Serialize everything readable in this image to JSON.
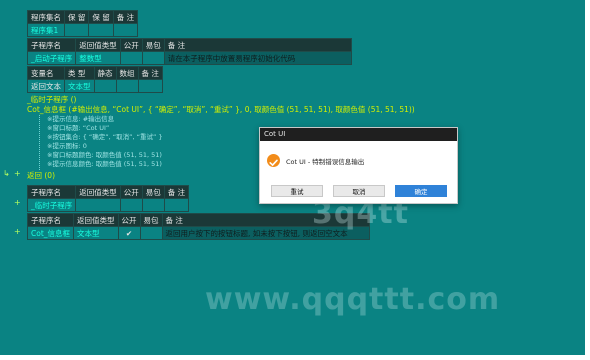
{
  "colors": {
    "background": "#0a8383",
    "header_cell": "#1b3837",
    "keyword": "#d4f000",
    "name_text": "#18ffe0",
    "dialog_default": "#2f82d8",
    "dialog_icon": "#f28c1a"
  },
  "program_table": {
    "headers": [
      "程序集名",
      "保 留",
      "保 留",
      "备 注"
    ],
    "row": [
      "程序集1",
      "",
      "",
      ""
    ]
  },
  "sub_table": {
    "headers": [
      "子程序名",
      "返回值类型",
      "公开",
      "易包",
      "备 注"
    ],
    "row": [
      "_启动子程序",
      "整数型",
      "",
      "",
      "请在本子程序中放置易程序初始化代码"
    ]
  },
  "var_table": {
    "headers": [
      "变量名",
      "类 型",
      "静态",
      "数组",
      "备 注"
    ],
    "row": [
      "返回文本",
      "文本型",
      "",
      "",
      ""
    ]
  },
  "code": {
    "line1": "_临时子程序 ()",
    "line2": "Cot_信息框 (#输出信息, “Cot UI”, { “确定”, “取消”, “重试” }, 0, 取颜色值 (51, 51, 51), 取颜色值 (51, 51, 51))",
    "p1": "※提示信息: #输出信息",
    "p2": "※窗口标题: “Cot UI”",
    "p3": "※按钮集合: { “确定”, “取消”, “重试” }",
    "p4": "※提示图标: 0",
    "p5": "※窗口标题颜色: 取颜色值 (51, 51, 51)",
    "p6": "※提示信息颜色: 取颜色值 (51, 51, 51)",
    "ret": "返回 (0)"
  },
  "sub_table2": {
    "headers": [
      "子程序名",
      "返回值类型",
      "公开",
      "易包",
      "备 注"
    ],
    "row": [
      "_临时子程序",
      "",
      "",
      "",
      ""
    ]
  },
  "sub_table3": {
    "headers": [
      "子程序名",
      "返回值类型",
      "公开",
      "易包",
      "备 注"
    ],
    "row": [
      "Cot_信息框",
      "文本型",
      "✔",
      "",
      "返回用户按下的按钮标题, 如未按下按钮, 则返回空文本"
    ]
  },
  "dialog": {
    "title": "Cot UI",
    "message": "Cot UI - 特制错误信息输出",
    "icon": "check-icon",
    "buttons": [
      "重试",
      "取消",
      "确定"
    ]
  },
  "watermarks": [
    "3q4tt",
    "www.qqqttt.com"
  ]
}
